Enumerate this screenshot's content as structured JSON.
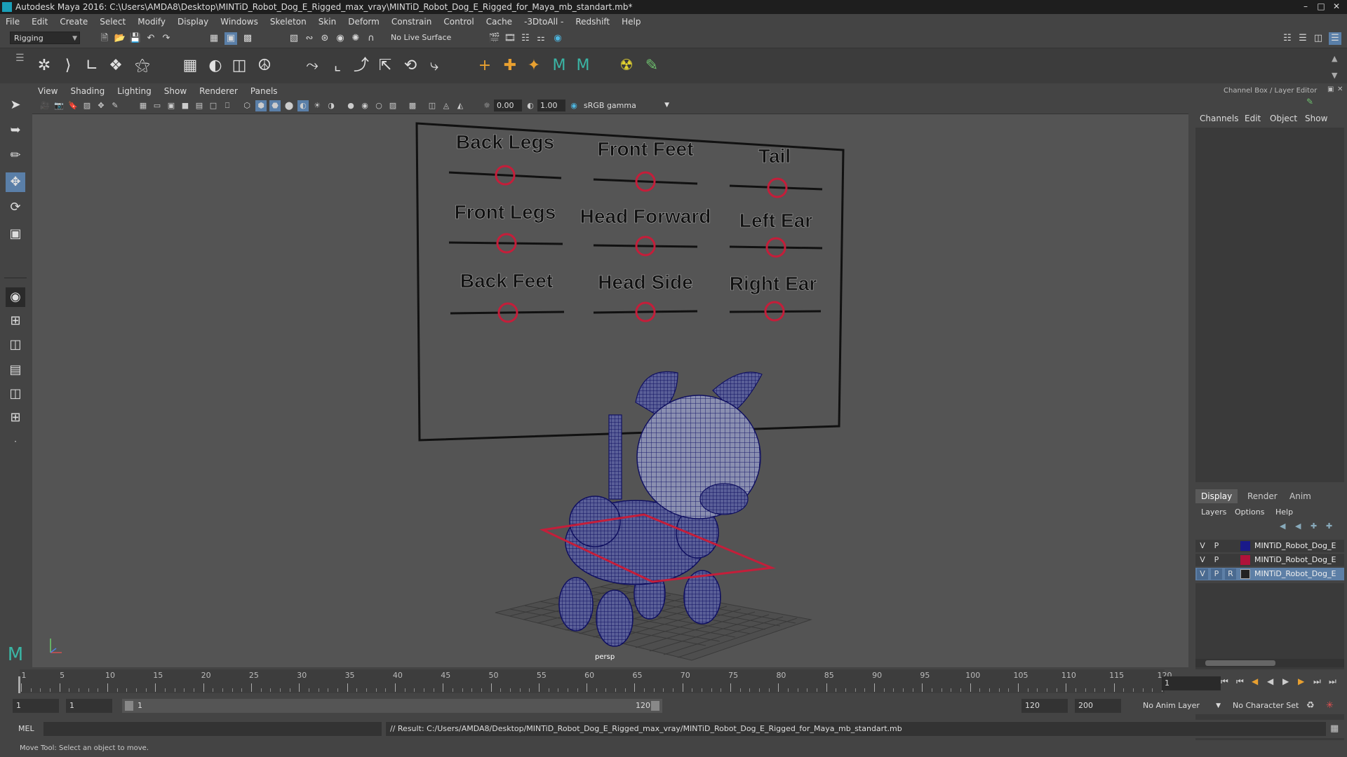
{
  "window": {
    "title": "Autodesk Maya 2016: C:\\Users\\AMDA8\\Desktop\\MINTiD_Robot_Dog_E_Rigged_max_vray\\MINTiD_Robot_Dog_E_Rigged_for_Maya_mb_standart.mb*"
  },
  "menubar": [
    "File",
    "Edit",
    "Create",
    "Select",
    "Modify",
    "Display",
    "Windows",
    "Skeleton",
    "Skin",
    "Deform",
    "Constrain",
    "Control",
    "Cache",
    "-3DtoAll -",
    "Redshift",
    "Help"
  ],
  "statusline": {
    "mode": "Rigging",
    "live_surface": "No Live Surface"
  },
  "viewport": {
    "menu": [
      "View",
      "Shading",
      "Lighting",
      "Show",
      "Renderer",
      "Panels"
    ],
    "exposure": "0.00",
    "gamma": "1.00",
    "color_space": "sRGB gamma",
    "camera": "persp",
    "board": {
      "labels": [
        "Back Legs",
        "Front Feet",
        "Tail",
        "Front Legs",
        "Head Forward",
        "Left Ear",
        "Back Feet",
        "Head Side",
        "Right Ear"
      ]
    }
  },
  "right_panel": {
    "title": "Channel Box / Layer Editor",
    "menu": [
      "Channels",
      "Edit",
      "Object",
      "Show"
    ],
    "layer_tabs": [
      "Display",
      "Render",
      "Anim"
    ],
    "layer_menu": [
      "Layers",
      "Options",
      "Help"
    ],
    "layers": [
      {
        "v": "V",
        "p": "P",
        "r": "",
        "color": "#1a1a8a",
        "name": "MINTiD_Robot_Dog_E"
      },
      {
        "v": "V",
        "p": "P",
        "r": "",
        "color": "#b0123a",
        "name": "MINTiD_Robot_Dog_E"
      },
      {
        "v": "V",
        "p": "P",
        "r": "R",
        "color": "#222222",
        "name": "MINTiD_Robot_Dog_E"
      }
    ]
  },
  "timeline": {
    "ticks": [
      "1",
      "5",
      "10",
      "15",
      "20",
      "25",
      "30",
      "35",
      "40",
      "45",
      "50",
      "55",
      "60",
      "65",
      "70",
      "75",
      "80",
      "85",
      "90",
      "95",
      "100",
      "105",
      "110",
      "115",
      "120"
    ],
    "current_frame": "1"
  },
  "range": {
    "start": "1",
    "playback_start": "1",
    "slider_start": "1",
    "slider_end": "120",
    "playback_end": "120",
    "end": "200",
    "anim_layer": "No Anim Layer",
    "character_set": "No Character Set"
  },
  "command": {
    "lang": "MEL",
    "result": "// Result: C:/Users/AMDA8/Desktop/MINTiD_Robot_Dog_E_Rigged_max_vray/MINTiD_Robot_Dog_E_Rigged_for_Maya_mb_standart.mb"
  },
  "helpline": "Move Tool: Select an object to move."
}
